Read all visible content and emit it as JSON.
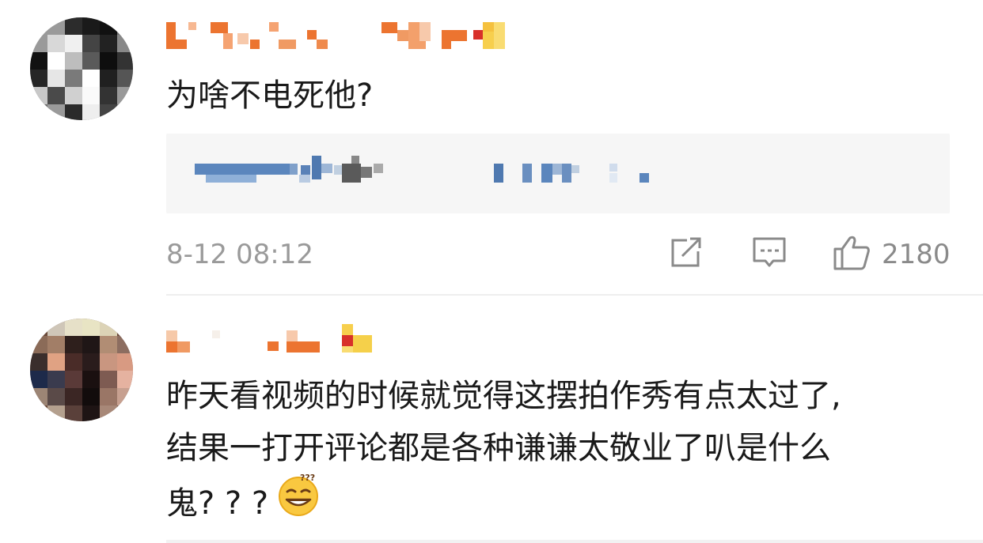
{
  "comments": [
    {
      "username": "",
      "text": "为啥不电死他?",
      "timestamp": "8-12 08:12",
      "likes": "2180",
      "reply_preview": ""
    },
    {
      "username": "",
      "text_line1": "昨天看视频的时候就觉得这摆拍作秀有点太过了,",
      "text_line2": "结果一打开评论都是各种谦谦太敬业了叭是什么",
      "text_line3": "鬼? ? ?",
      "emoji": "dizzy-grin-emoji"
    }
  ],
  "icons": {
    "share": "share-icon",
    "reply": "comment-icon",
    "like": "thumbs-up-icon"
  },
  "colors": {
    "meta_gray": "#9a9a9a",
    "reply_bg": "#f6f6f6",
    "username_orange": "#ec7430"
  }
}
